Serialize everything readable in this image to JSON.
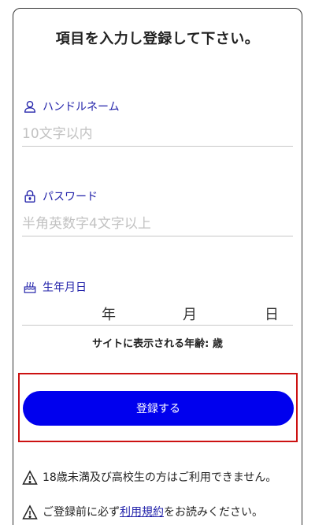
{
  "form": {
    "title": "項目を入力し登録して下さい。",
    "handle": {
      "label": "ハンドルネーム",
      "placeholder": "10文字以内",
      "icon": "person-outline-icon"
    },
    "password": {
      "label": "パスワード",
      "placeholder": "半角英数字4文字以上",
      "icon": "lock-icon"
    },
    "birthdate": {
      "label": "生年月日",
      "icon": "birthday-cake-icon",
      "year_unit": "年",
      "month_unit": "月",
      "day_unit": "日"
    },
    "age_display": "サイトに表示される年齢: 歳",
    "submit_label": "登録する"
  },
  "notices": {
    "age_warning": "18歳未満及び高校生の方はご利用できません。",
    "terms_prefix": "ご登録前に必ず",
    "terms_link": "利用規約",
    "terms_suffix": "をお読みください。",
    "icon": "warning-triangle-icon"
  },
  "colors": {
    "accent_blue": "#0000ee",
    "label_blue": "#2222aa",
    "highlight_red": "#cc1111"
  }
}
